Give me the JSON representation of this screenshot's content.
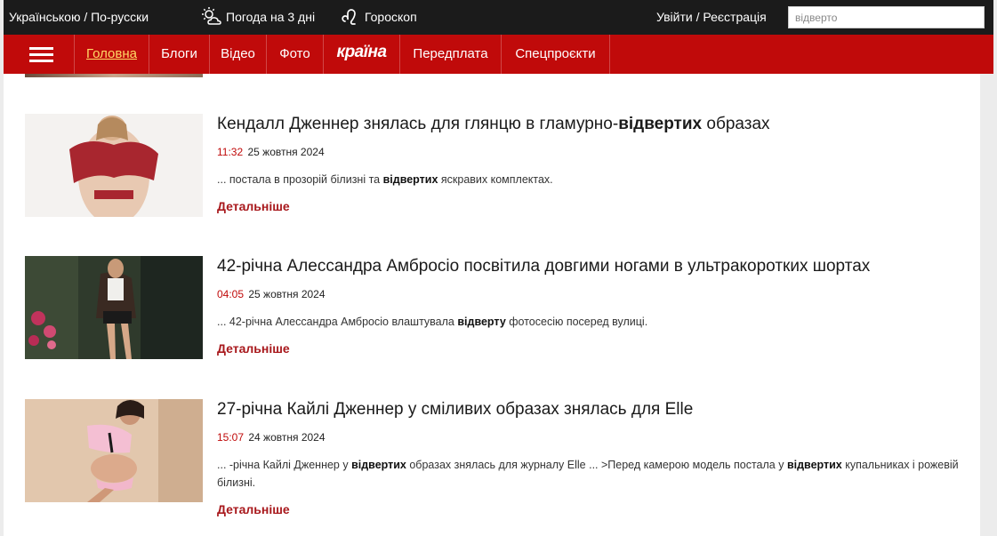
{
  "topbar": {
    "lang": "Українською / По-русски",
    "weather": "Погода на 3 дні",
    "horoscope": "Гороскоп",
    "login": "Увійти / Реєстрація",
    "search_value": "відверто"
  },
  "nav": {
    "home": "Головна",
    "blogs": "Блоги",
    "video": "Відео",
    "photo": "Фото",
    "logo": "країна",
    "subscription": "Передплата",
    "special": "Спецпроєкти"
  },
  "colors": {
    "nav_red": "#c00a0a",
    "top_dark": "#1b1b1b",
    "link_red": "#a8181c",
    "home_active": "#ffd966"
  },
  "prev_more": "Детальніше",
  "articles": [
    {
      "title_pre": "Кендалл Дженнер знялась для глянцю в гламурно-",
      "title_bold": "відвертих",
      "title_post": " образах",
      "time": "11:32",
      "date": "25 жовтня 2024",
      "snippet_1": "... постала в прозорій білизні та ",
      "snippet_b1": "відвертих",
      "snippet_2": " яскравих комплектах.",
      "more": "Детальніше"
    },
    {
      "title": "42-річна Алессандра Амбросіо посвітила довгими ногами в ультракоротких шортах",
      "time": "04:05",
      "date": "25 жовтня 2024",
      "snippet_1": "... 42-річна Алессандра Амбросіо влаштувала ",
      "snippet_b1": "відверту",
      "snippet_2": " фотосесію посеред вулиці.",
      "more": "Детальніше"
    },
    {
      "title": "27-річна Кайлі Дженнер у сміливих образах знялась для Elle",
      "time": "15:07",
      "date": "24 жовтня 2024",
      "snippet_1": "... -річна Кайлі Дженнер у ",
      "snippet_b1": "відвертих",
      "snippet_2": " образах знялась для журналу Elle ... >Перед камерою модель постала у ",
      "snippet_b2": "відвертих",
      "snippet_3": " купальниках і рожевій білизні.",
      "more": "Детальніше"
    }
  ]
}
